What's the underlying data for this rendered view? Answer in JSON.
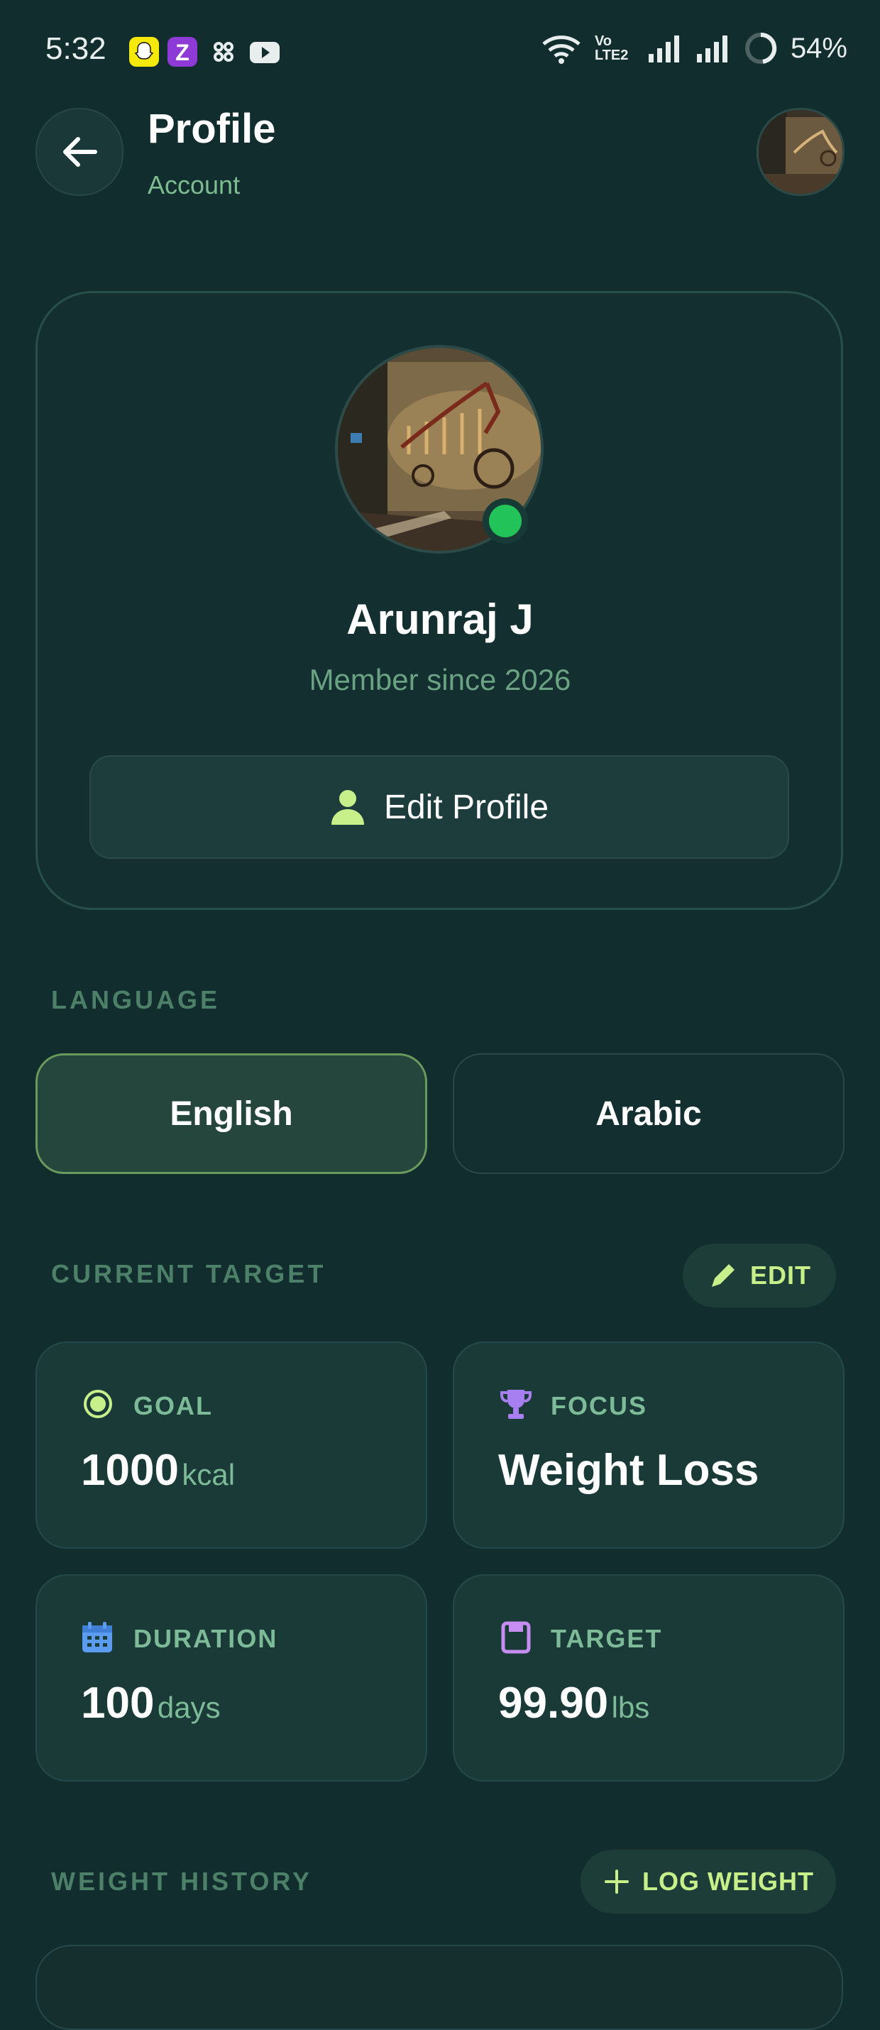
{
  "status_bar": {
    "time": "5:32",
    "battery": "54%",
    "network": "Vo LTE2"
  },
  "header": {
    "title": "Profile",
    "subtitle": "Account"
  },
  "profile": {
    "name": "Arunraj J",
    "member_since": "Member since 2026",
    "edit_button": "Edit Profile",
    "online": true
  },
  "language": {
    "section_label": "LANGUAGE",
    "options": [
      "English",
      "Arabic"
    ],
    "selected": "English"
  },
  "current_target": {
    "section_label": "CURRENT TARGET",
    "edit_button": "EDIT",
    "cards": [
      {
        "label": "GOAL",
        "value": "1000",
        "unit": "kcal",
        "icon": "target-icon",
        "icon_color": "#c7f08a"
      },
      {
        "label": "FOCUS",
        "value": "Weight Loss",
        "unit": "",
        "icon": "trophy-icon",
        "icon_color": "#a77ff0"
      },
      {
        "label": "DURATION",
        "value": "100",
        "unit": "days",
        "icon": "calendar-icon",
        "icon_color": "#5b9cf0"
      },
      {
        "label": "TARGET",
        "value": "99.90",
        "unit": "lbs",
        "icon": "scale-icon",
        "icon_color": "#c58ef0"
      }
    ]
  },
  "weight_history": {
    "section_label": "WEIGHT HISTORY",
    "log_button": "LOG WEIGHT"
  },
  "colors": {
    "background": "#122d2d",
    "accent": "#c7f08a",
    "muted_green": "#7dbb98",
    "online": "#22c45a"
  }
}
